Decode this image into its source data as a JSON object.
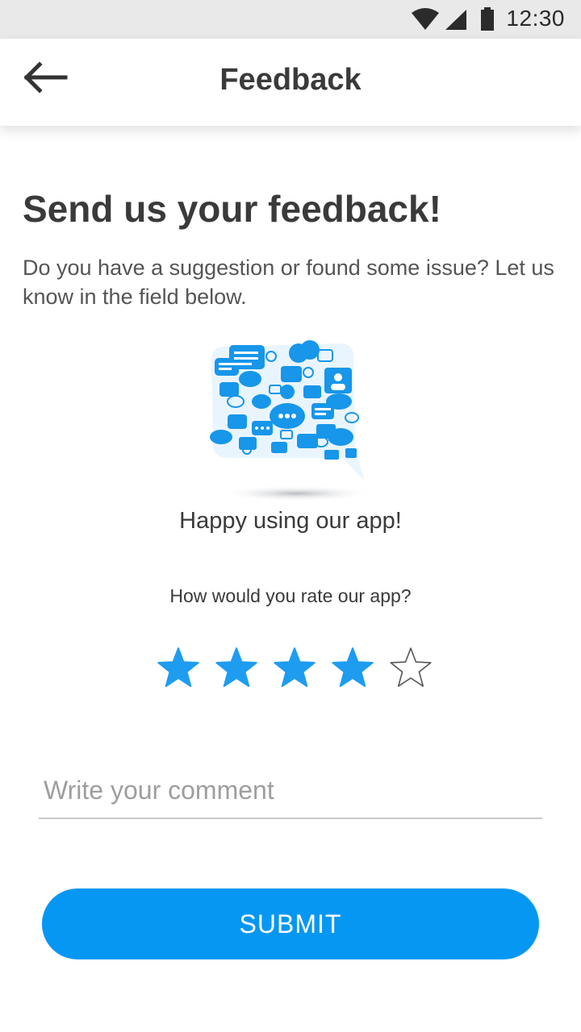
{
  "status_bar": {
    "time": "12:30",
    "icons": [
      "wifi-icon",
      "signal-icon",
      "battery-icon"
    ]
  },
  "app_bar": {
    "back_icon": "arrow-left-icon",
    "title": "Feedback"
  },
  "content": {
    "heading": "Send us your feedback!",
    "subtext": "Do you have a suggestion or found some issue? Let us know in the field below.",
    "illustration_icon": "chat-bubbles-illustration",
    "mood_text": "Happy using our app!",
    "rating_question": "How would you rate our app?",
    "rating": {
      "value": 4,
      "max": 5
    },
    "comment": {
      "placeholder": "Write your comment",
      "value": ""
    },
    "submit_label": "SUBMIT"
  },
  "colors": {
    "accent": "#0597f2",
    "star_filled": "#1e9cf0",
    "star_empty_stroke": "#555555",
    "status_bar_bg": "#e9e9e9"
  }
}
